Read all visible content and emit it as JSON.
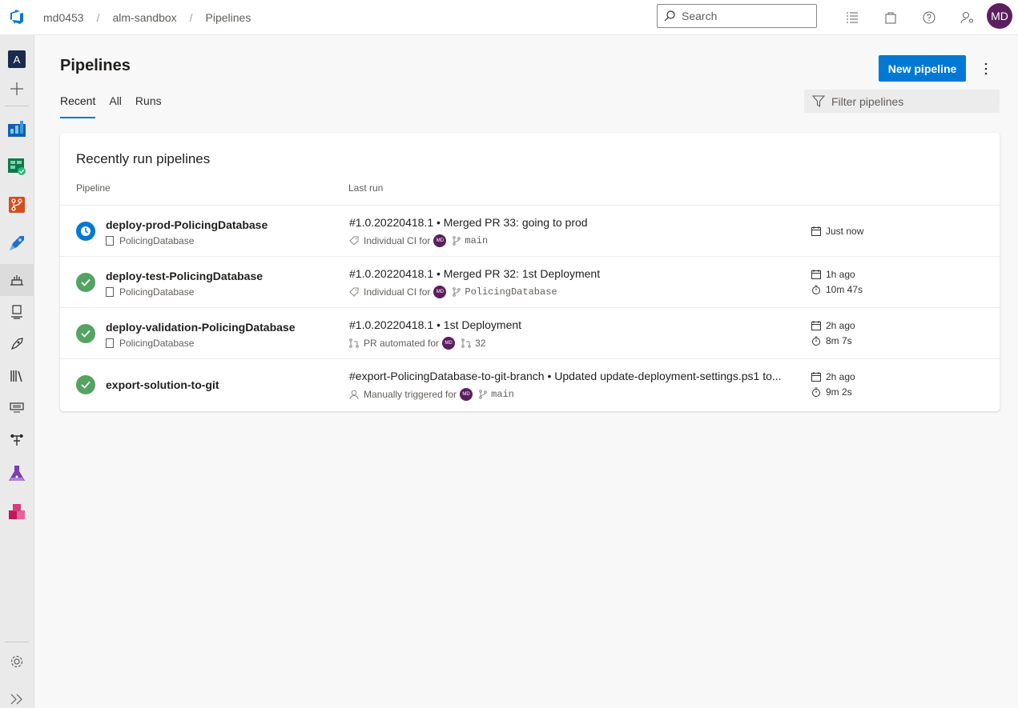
{
  "breadcrumb": {
    "org": "md0453",
    "project": "alm-sandbox",
    "page": "Pipelines"
  },
  "search": {
    "placeholder": "Search"
  },
  "user": {
    "initials": "MD"
  },
  "rail": {
    "project_initial": "A"
  },
  "page": {
    "title": "Pipelines",
    "new_button": "New pipeline"
  },
  "tabs": [
    {
      "label": "Recent",
      "active": true
    },
    {
      "label": "All"
    },
    {
      "label": "Runs"
    }
  ],
  "filter": {
    "placeholder": "Filter pipelines"
  },
  "card": {
    "title": "Recently run pipelines",
    "col_pipeline": "Pipeline",
    "col_last_run": "Last run"
  },
  "pipelines": [
    {
      "name": "deploy-prod-PolicingDatabase",
      "repo": "PolicingDatabase",
      "status": "running",
      "run_title": "#1.0.20220418.1 • Merged PR 33: going to prod",
      "trigger": "Individual CI for",
      "trigger_icon": "tag-icon",
      "avatar": "MD",
      "ref": "main",
      "ref_icon": "branch-icon",
      "when": "Just now",
      "duration": ""
    },
    {
      "name": "deploy-test-PolicingDatabase",
      "repo": "PolicingDatabase",
      "status": "succeeded",
      "run_title": "#1.0.20220418.1 • Merged PR 32: 1st Deployment",
      "trigger": "Individual CI for",
      "trigger_icon": "tag-icon",
      "avatar": "MD",
      "ref": "PolicingDatabase",
      "ref_icon": "branch-icon",
      "when": "1h ago",
      "duration": "10m 47s"
    },
    {
      "name": "deploy-validation-PolicingDatabase",
      "repo": "PolicingDatabase",
      "status": "succeeded",
      "run_title": "#1.0.20220418.1 • 1st Deployment",
      "trigger": "PR automated for",
      "trigger_icon": "pull-request-icon",
      "avatar": "MD",
      "ref": "32",
      "ref_icon": "pull-request-icon",
      "when": "2h ago",
      "duration": "8m 7s"
    },
    {
      "name": "export-solution-to-git",
      "repo": "",
      "status": "succeeded",
      "run_title": "#export-PolicingDatabase-to-git-branch • Updated update-deployment-settings.ps1 to...",
      "trigger": "Manually triggered for",
      "trigger_icon": "person-icon",
      "avatar": "MD",
      "ref": "main",
      "ref_icon": "branch-icon",
      "when": "2h ago",
      "duration": "9m 2s"
    }
  ],
  "colors": {
    "accent": "#0078d4",
    "success": "#55a362",
    "avatar": "#5c1e5f"
  }
}
